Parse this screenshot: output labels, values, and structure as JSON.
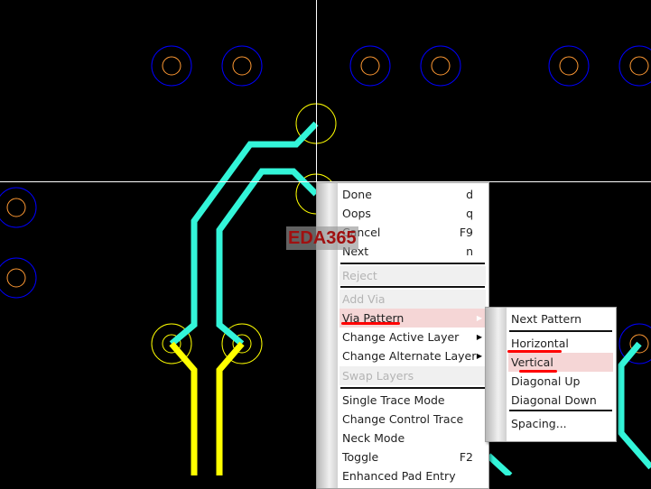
{
  "watermark": "EDA365",
  "colors": {
    "trace_top": "#33f5d9",
    "trace_bottom": "#ffff00",
    "pad_outer": "#0000ff",
    "pad_drill": "#ff9933",
    "via": "#ffff00",
    "crosshair": "#ffffff",
    "highlight": "#f5d6d6",
    "annotation": "#ff0000"
  },
  "context_menu": {
    "items": [
      {
        "label": "Done",
        "shortcut": "d"
      },
      {
        "label": "Oops",
        "shortcut": "q"
      },
      {
        "label": "Cancel",
        "shortcut": "F9"
      },
      {
        "label": "Next",
        "shortcut": "n"
      },
      {
        "label": "Reject",
        "disabled": true
      },
      {
        "label": "Add Via",
        "disabled": true
      },
      {
        "label": "Via Pattern",
        "submenu": true,
        "highlighted": true
      },
      {
        "label": "Change Active Layer",
        "submenu": true
      },
      {
        "label": "Change Alternate Layer",
        "submenu": true
      },
      {
        "label": "Swap Layers",
        "disabled": true
      },
      {
        "label": "Single Trace Mode"
      },
      {
        "label": "Change Control Trace"
      },
      {
        "label": "Neck Mode"
      },
      {
        "label": "Toggle",
        "shortcut": "F2"
      },
      {
        "label": "Enhanced Pad Entry"
      }
    ]
  },
  "submenu": {
    "items": [
      {
        "label": "Next Pattern"
      },
      {
        "label": "Horizontal"
      },
      {
        "label": "Vertical",
        "highlighted": true
      },
      {
        "label": "Diagonal Up"
      },
      {
        "label": "Diagonal Down"
      },
      {
        "label": "Spacing..."
      }
    ]
  }
}
